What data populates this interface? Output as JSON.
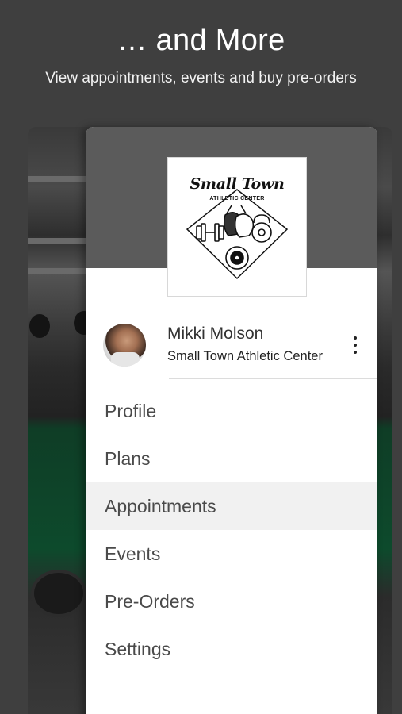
{
  "header": {
    "title": "… and More",
    "subtitle": "View appointments, events and buy pre-orders"
  },
  "logo": {
    "title": "Small Town",
    "subtitle": "ATHLETIC CENTER"
  },
  "user": {
    "name": "Mikki Molson",
    "gym": "Small Town Athletic Center",
    "more_icon": "more-vert-icon"
  },
  "menu": {
    "items": [
      {
        "label": "Profile",
        "active": false
      },
      {
        "label": "Plans",
        "active": false
      },
      {
        "label": "Appointments",
        "active": true
      },
      {
        "label": "Events",
        "active": false
      },
      {
        "label": "Pre-Orders",
        "active": false
      },
      {
        "label": "Settings",
        "active": false
      }
    ]
  },
  "colors": {
    "background": "#3f3f3f",
    "drawer_header": "#5b5b5b",
    "active_item": "#f1f1f1"
  }
}
